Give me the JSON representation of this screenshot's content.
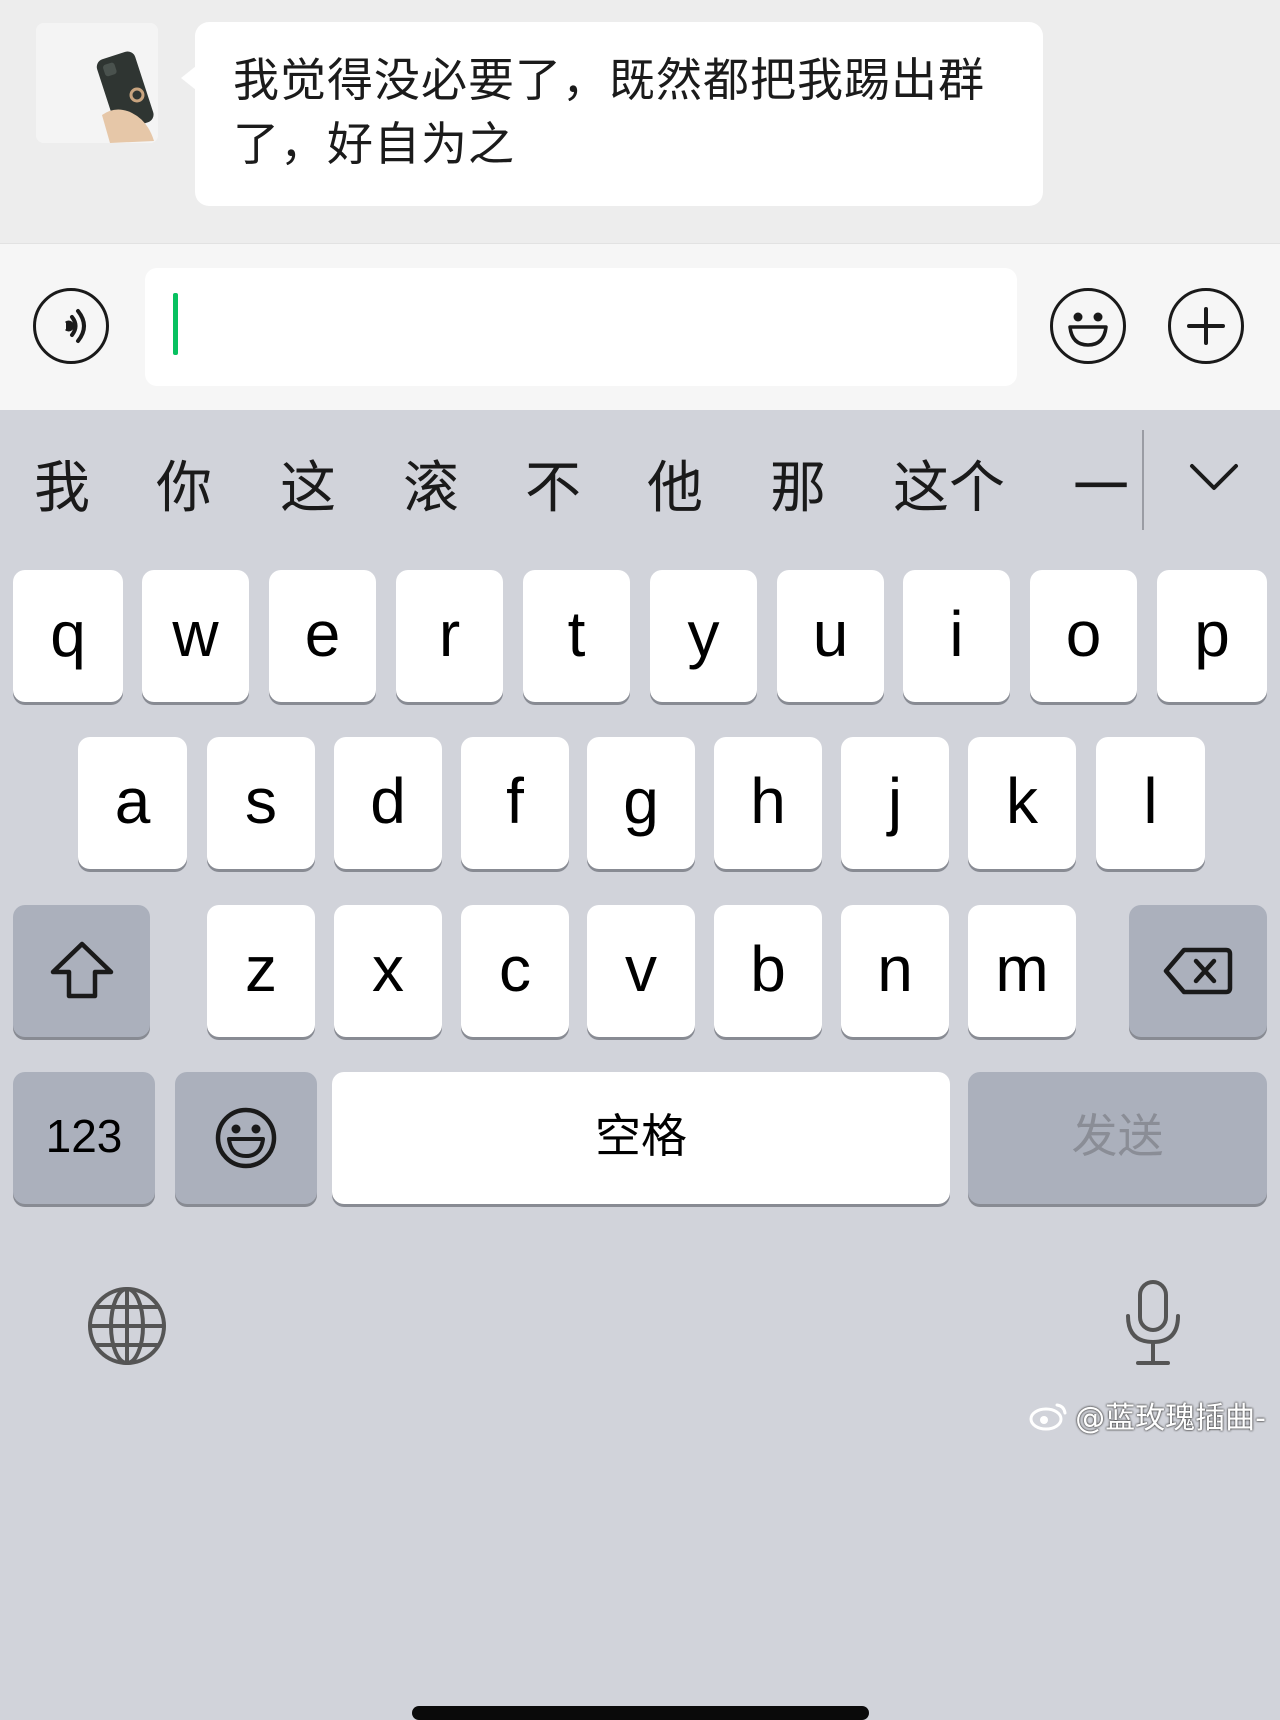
{
  "chat": {
    "message": "我觉得没必要了，既然都把我踢出群了，好自为之"
  },
  "input_bar": {
    "voice_icon": "voice-icon",
    "emoji_icon": "emoji-icon",
    "plus_icon": "plus-icon",
    "accent_color": "#07c160"
  },
  "keyboard": {
    "candidates": [
      "我",
      "你",
      "这",
      "滚",
      "不",
      "他",
      "那",
      "这个",
      "一"
    ],
    "row1": [
      "q",
      "w",
      "e",
      "r",
      "t",
      "y",
      "u",
      "i",
      "o",
      "p"
    ],
    "row2": [
      "a",
      "s",
      "d",
      "f",
      "g",
      "h",
      "j",
      "k",
      "l"
    ],
    "row3": [
      "z",
      "x",
      "c",
      "v",
      "b",
      "n",
      "m"
    ],
    "numbers_label": "123",
    "space_label": "空格",
    "send_label": "发送"
  },
  "watermark": "@蓝玫瑰插曲-"
}
